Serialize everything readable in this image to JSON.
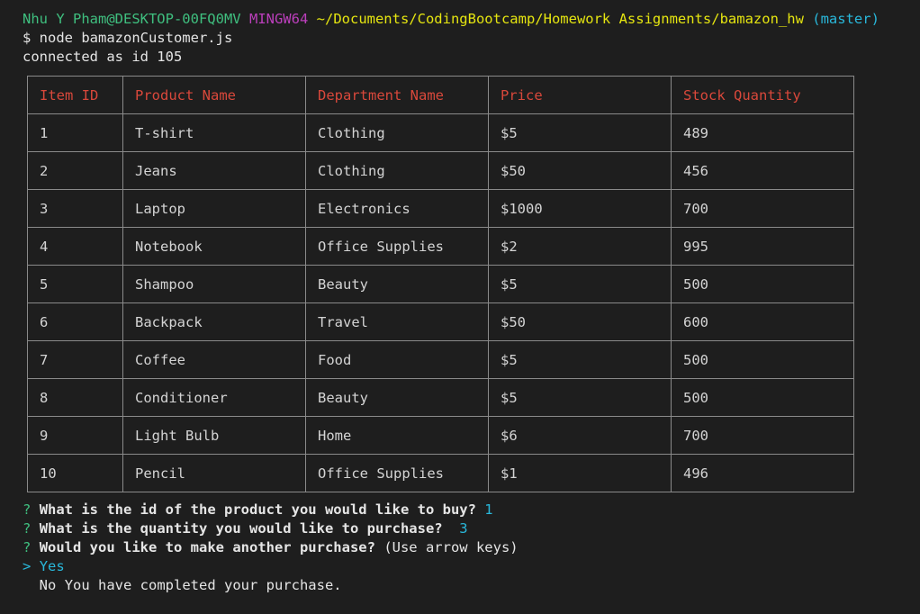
{
  "prompt": {
    "user_host": "Nhu Y Pham@DESKTOP-00FQ0MV",
    "system": "MINGW64",
    "path": "~/Documents/CodingBootcamp/Homework Assignments/bamazon_hw",
    "branch": "(master)"
  },
  "command": "$ node bamazonCustomer.js",
  "connected": "connected as id 105",
  "table": {
    "headers": [
      "Item ID",
      "Product Name",
      "Department Name",
      "Price",
      "Stock Quantity"
    ],
    "rows": [
      [
        "1",
        "T-shirt",
        "Clothing",
        "$5",
        "489"
      ],
      [
        "2",
        "Jeans",
        "Clothing",
        "$50",
        "456"
      ],
      [
        "3",
        "Laptop",
        "Electronics",
        "$1000",
        "700"
      ],
      [
        "4",
        "Notebook",
        "Office Supplies",
        "$2",
        "995"
      ],
      [
        "5",
        "Shampoo",
        "Beauty",
        "$5",
        "500"
      ],
      [
        "6",
        "Backpack",
        "Travel",
        "$50",
        "600"
      ],
      [
        "7",
        "Coffee",
        "Food",
        "$5",
        "500"
      ],
      [
        "8",
        "Conditioner",
        "Beauty",
        "$5",
        "500"
      ],
      [
        "9",
        "Light Bulb",
        "Home",
        "$6",
        "700"
      ],
      [
        "10",
        "Pencil",
        "Office Supplies",
        "$1",
        "496"
      ]
    ]
  },
  "questions": [
    {
      "mark": "?",
      "text": "What is the id of the product you would like to buy?",
      "answer": "1"
    },
    {
      "mark": "?",
      "text": "What is the quantity you would like to purchase?",
      "answer": "3"
    },
    {
      "mark": "?",
      "text": "Would you like to make another purchase?",
      "hint": "(Use arrow keys)"
    }
  ],
  "choices": {
    "pointer": ">",
    "selected": "Yes",
    "other": "No",
    "message": "You have completed your purchase."
  },
  "colors": {
    "user_host": "#3fbf7f",
    "system": "#bc3fbc",
    "path": "#e5e510",
    "branch": "#29b8db",
    "table_header": "#d9483b",
    "table_border": "#8a8a8a",
    "background": "#1e1e1e"
  }
}
